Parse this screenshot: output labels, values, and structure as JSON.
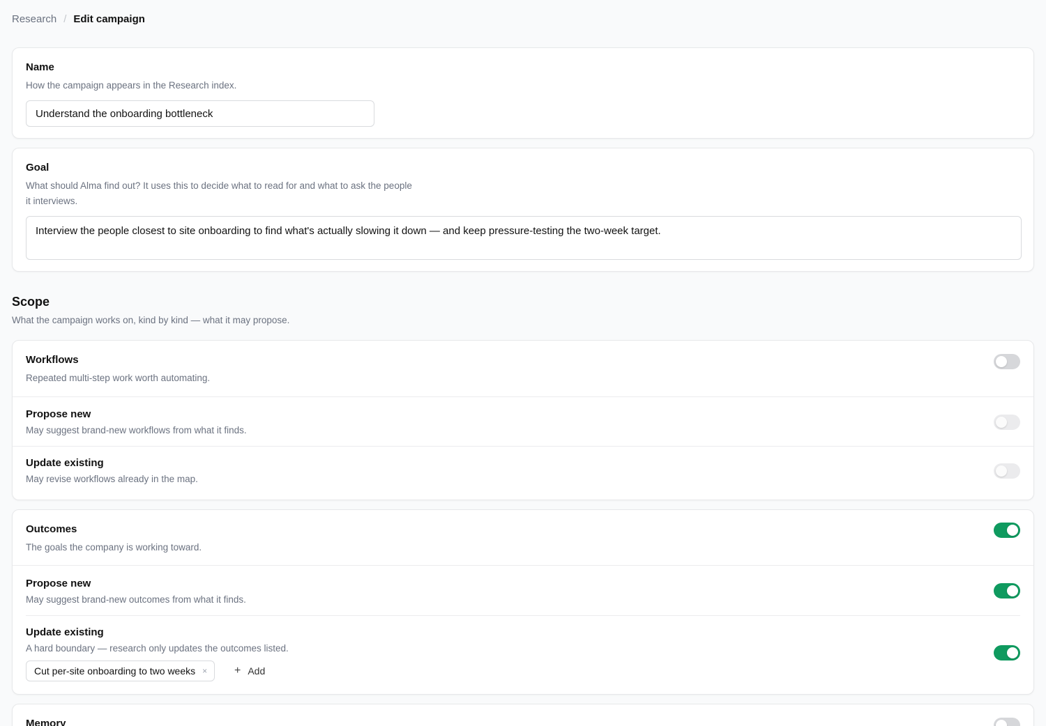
{
  "breadcrumb": {
    "parent": "Research",
    "separator": "/",
    "current": "Edit campaign"
  },
  "name_card": {
    "title": "Name",
    "description": "How the campaign appears in the Research index.",
    "value": "Understand the onboarding bottleneck"
  },
  "goal_card": {
    "title": "Goal",
    "description_line1": "What should Alma find out? It uses this to decide what to read for and what to ask the people",
    "description_line2": "it interviews.",
    "value": "Interview the people closest to site onboarding to find what's actually slowing it down — and keep pressure-testing the two-week target."
  },
  "scope": {
    "heading": "Scope",
    "description": "What the campaign works on, kind by kind — what it may propose."
  },
  "workflows": {
    "title": "Workflows",
    "description": "Repeated multi-step work worth automating.",
    "enabled": false,
    "propose_new": {
      "title": "Propose new",
      "description": "May suggest brand-new workflows from what it finds.",
      "enabled": false
    },
    "update_existing": {
      "title": "Update existing",
      "description": "May revise workflows already in the map.",
      "enabled": false
    }
  },
  "outcomes": {
    "title": "Outcomes",
    "description": "The goals the company is working toward.",
    "enabled": true,
    "propose_new": {
      "title": "Propose new",
      "description": "May suggest brand-new outcomes from what it finds.",
      "enabled": true
    },
    "update_existing": {
      "title": "Update existing",
      "description": "A hard boundary — research only updates the outcomes listed.",
      "enabled": true,
      "chips": [
        "Cut per-site onboarding to two weeks"
      ],
      "chip_remove_glyph": "×",
      "add_label": "Add",
      "add_glyph": "+"
    }
  },
  "memory": {
    "title": "Memory",
    "enabled": false
  },
  "colors": {
    "toggle_on": "#0f9a5f",
    "toggle_off": "#d6d7da",
    "toggle_disabled": "#ebebed"
  }
}
